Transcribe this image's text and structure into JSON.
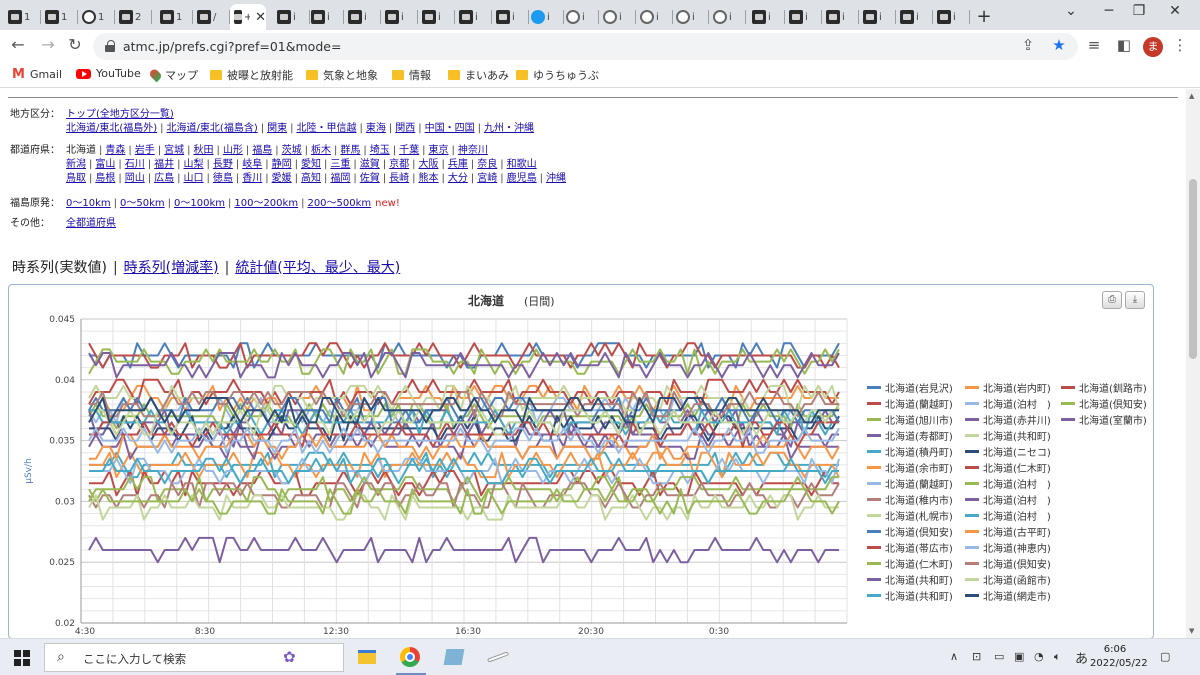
{
  "browser": {
    "tabs": [
      {
        "label": "1"
      },
      {
        "label": "1"
      },
      {
        "label": "1"
      },
      {
        "label": "2"
      },
      {
        "label": "1"
      },
      {
        "label": "/"
      },
      {
        "label": "+",
        "active": true
      },
      {
        "label": "i"
      },
      {
        "label": "i"
      },
      {
        "label": "i"
      },
      {
        "label": "i"
      },
      {
        "label": "i"
      },
      {
        "label": "i"
      },
      {
        "label": "i"
      },
      {
        "label": "i"
      },
      {
        "label": "i"
      },
      {
        "label": "i"
      },
      {
        "label": "i"
      },
      {
        "label": "i"
      },
      {
        "label": "i"
      },
      {
        "label": "i"
      },
      {
        "label": "i"
      },
      {
        "label": "i"
      },
      {
        "label": "i"
      },
      {
        "label": "i"
      },
      {
        "label": "i"
      }
    ],
    "new_tab": "+",
    "url": "atmc.jp/prefs.cgi?pref=01&mode=",
    "profile_initial": "ま",
    "bookmarks": [
      {
        "label": "Gmail",
        "icon": "gmail"
      },
      {
        "label": "YouTube",
        "icon": "youtube"
      },
      {
        "label": "マップ",
        "icon": "maps"
      },
      {
        "label": "被曝と放射能",
        "icon": "folder"
      },
      {
        "label": "気象と地象",
        "icon": "folder"
      },
      {
        "label": "情報",
        "icon": "folder"
      },
      {
        "label": "まいあみ",
        "icon": "folder"
      },
      {
        "label": "ゆうちゅうぶ",
        "icon": "folder"
      }
    ]
  },
  "nav": {
    "region_label": "地方区分：",
    "region_rows": [
      [
        {
          "text": "トップ(全地方区分一覧)",
          "link": true
        }
      ],
      [
        {
          "text": "北海道/東北(福島外)",
          "link": true
        },
        {
          "text": "北海道/東北(福島含)",
          "link": true
        },
        {
          "text": "関東",
          "link": true
        },
        {
          "text": "北陸・甲信越",
          "link": true
        },
        {
          "text": "東海",
          "link": true
        },
        {
          "text": "関西",
          "link": true
        },
        {
          "text": "中国・四国",
          "link": true
        },
        {
          "text": "九州・沖縄",
          "link": true
        }
      ]
    ],
    "pref_label": "都道府県：",
    "pref_rows": [
      [
        {
          "text": "北海道",
          "link": false
        },
        {
          "text": "青森",
          "link": true
        },
        {
          "text": "岩手",
          "link": true
        },
        {
          "text": "宮城",
          "link": true
        },
        {
          "text": "秋田",
          "link": true
        },
        {
          "text": "山形",
          "link": true
        },
        {
          "text": "福島",
          "link": true
        },
        {
          "text": "茨城",
          "link": true
        },
        {
          "text": "栃木",
          "link": true
        },
        {
          "text": "群馬",
          "link": true
        },
        {
          "text": "埼玉",
          "link": true
        },
        {
          "text": "千葉",
          "link": true
        },
        {
          "text": "東京",
          "link": true
        },
        {
          "text": "神奈川",
          "link": true
        }
      ],
      [
        {
          "text": "新潟",
          "link": true
        },
        {
          "text": "富山",
          "link": true
        },
        {
          "text": "石川",
          "link": true
        },
        {
          "text": "福井",
          "link": true
        },
        {
          "text": "山梨",
          "link": true
        },
        {
          "text": "長野",
          "link": true
        },
        {
          "text": "岐阜",
          "link": true
        },
        {
          "text": "静岡",
          "link": true
        },
        {
          "text": "愛知",
          "link": true
        },
        {
          "text": "三重",
          "link": true
        },
        {
          "text": "滋賀",
          "link": true
        },
        {
          "text": "京都",
          "link": true
        },
        {
          "text": "大阪",
          "link": true
        },
        {
          "text": "兵庫",
          "link": true
        },
        {
          "text": "奈良",
          "link": true
        },
        {
          "text": "和歌山",
          "link": true
        }
      ],
      [
        {
          "text": "鳥取",
          "link": true
        },
        {
          "text": "島根",
          "link": true
        },
        {
          "text": "岡山",
          "link": true
        },
        {
          "text": "広島",
          "link": true
        },
        {
          "text": "山口",
          "link": true
        },
        {
          "text": "徳島",
          "link": true
        },
        {
          "text": "香川",
          "link": true
        },
        {
          "text": "愛媛",
          "link": true
        },
        {
          "text": "高知",
          "link": true
        },
        {
          "text": "福岡",
          "link": true
        },
        {
          "text": "佐賀",
          "link": true
        },
        {
          "text": "長崎",
          "link": true
        },
        {
          "text": "熊本",
          "link": true
        },
        {
          "text": "大分",
          "link": true
        },
        {
          "text": "宮崎",
          "link": true
        },
        {
          "text": "鹿児島",
          "link": true
        },
        {
          "text": "沖縄",
          "link": true
        }
      ]
    ],
    "fukushima_label": "福島原発：",
    "fukushima_links": [
      "0〜10km",
      "0〜50km",
      "0〜100km",
      "100〜200km",
      "200〜500km"
    ],
    "new_badge": "new!",
    "other_label": "その他：",
    "other_links": [
      "全都道府県"
    ]
  },
  "view_tabs": {
    "current": "時系列(実数値)",
    "links": [
      "時系列(増減率)",
      "統計値(平均、最少、最大)"
    ]
  },
  "chart_data": {
    "type": "line",
    "title": "北海道",
    "subtitle": "(日間)",
    "ylabel": "μSv/h",
    "ylim": [
      0.02,
      0.045
    ],
    "yticks": [
      "0.045",
      "0.04",
      "0.035",
      "0.03",
      "0.025",
      "0.02"
    ],
    "xticks": [
      "4:30",
      "8:30",
      "12:30",
      "16:30",
      "20:30",
      "0:30"
    ],
    "series": [
      {
        "name": "北海道(岩見沢)",
        "color": "#4a7ebb",
        "base": 0.042
      },
      {
        "name": "北海道(岩内町)",
        "color": "#f79646",
        "base": 0.0385
      },
      {
        "name": "北海道(釧路市)",
        "color": "#be4b48",
        "base": 0.042
      },
      {
        "name": "北海道(蘭越町)",
        "color": "#be4b48",
        "base": 0.039
      },
      {
        "name": "北海道(泊村　)",
        "color": "#98b9e3",
        "base": 0.0375
      },
      {
        "name": "北海道(倶知安)",
        "color": "#98b954",
        "base": 0.0415
      },
      {
        "name": "北海道(旭川市)",
        "color": "#98b954",
        "base": 0.037
      },
      {
        "name": "北海道(赤井川)",
        "color": "#7d60a0",
        "base": 0.0365
      },
      {
        "name": "北海道(室蘭市)",
        "color": "#7d60a0",
        "base": 0.0412
      },
      {
        "name": "北海道(寿都町)",
        "color": "#7d60a0",
        "base": 0.0355
      },
      {
        "name": "北海道(共和町)",
        "color": "#c3d69b",
        "base": 0.0385
      },
      {
        "name": "北海道(積丹町)",
        "color": "#46aac4",
        "base": 0.033
      },
      {
        "name": "北海道(ニセコ)",
        "color": "#2c4d75",
        "base": 0.036
      },
      {
        "name": "北海道(余市町)",
        "color": "#f79646",
        "base": 0.033
      },
      {
        "name": "北海道(仁木町)",
        "color": "#be4b48",
        "base": 0.0315
      },
      {
        "name": "北海道(蘭越町)",
        "color": "#98b9e3",
        "base": 0.0325
      },
      {
        "name": "北海道(泊村　)",
        "color": "#98b954",
        "base": 0.031
      },
      {
        "name": "北海道(稚内市)",
        "color": "#b37f7a",
        "base": 0.0305
      },
      {
        "name": "北海道(泊村　)",
        "color": "#7d60a0",
        "base": 0.0345
      },
      {
        "name": "北海道(札幌市)",
        "color": "#c3d69b",
        "base": 0.0295
      },
      {
        "name": "北海道(泊村　)",
        "color": "#46aac4",
        "base": 0.0365
      },
      {
        "name": "北海道(倶知安)",
        "color": "#4a7ebb",
        "base": 0.0375
      },
      {
        "name": "北海道(古平町)",
        "color": "#f79646",
        "base": 0.0345
      },
      {
        "name": "北海道(帯広市)",
        "color": "#be4b48",
        "base": 0.0355
      },
      {
        "name": "北海道(神恵内)",
        "color": "#98b9e3",
        "base": 0.035
      },
      {
        "name": "北海道(仁木町)",
        "color": "#98b954",
        "base": 0.03
      },
      {
        "name": "北海道(倶知安)",
        "color": "#b37f7a",
        "base": 0.038
      },
      {
        "name": "北海道(共和町)",
        "color": "#7d60a0",
        "base": 0.026
      },
      {
        "name": "北海道(函館市)",
        "color": "#c3d69b",
        "base": 0.0365
      },
      {
        "name": "北海道(共和町)",
        "color": "#46aac4",
        "base": 0.0325
      },
      {
        "name": "北海道(網走市)",
        "color": "#2c4d75",
        "base": 0.0375
      }
    ]
  },
  "taskbar": {
    "search_placeholder": "ここに入力して検索",
    "ime": "あ",
    "time": "6:06",
    "date": "2022/05/22"
  }
}
